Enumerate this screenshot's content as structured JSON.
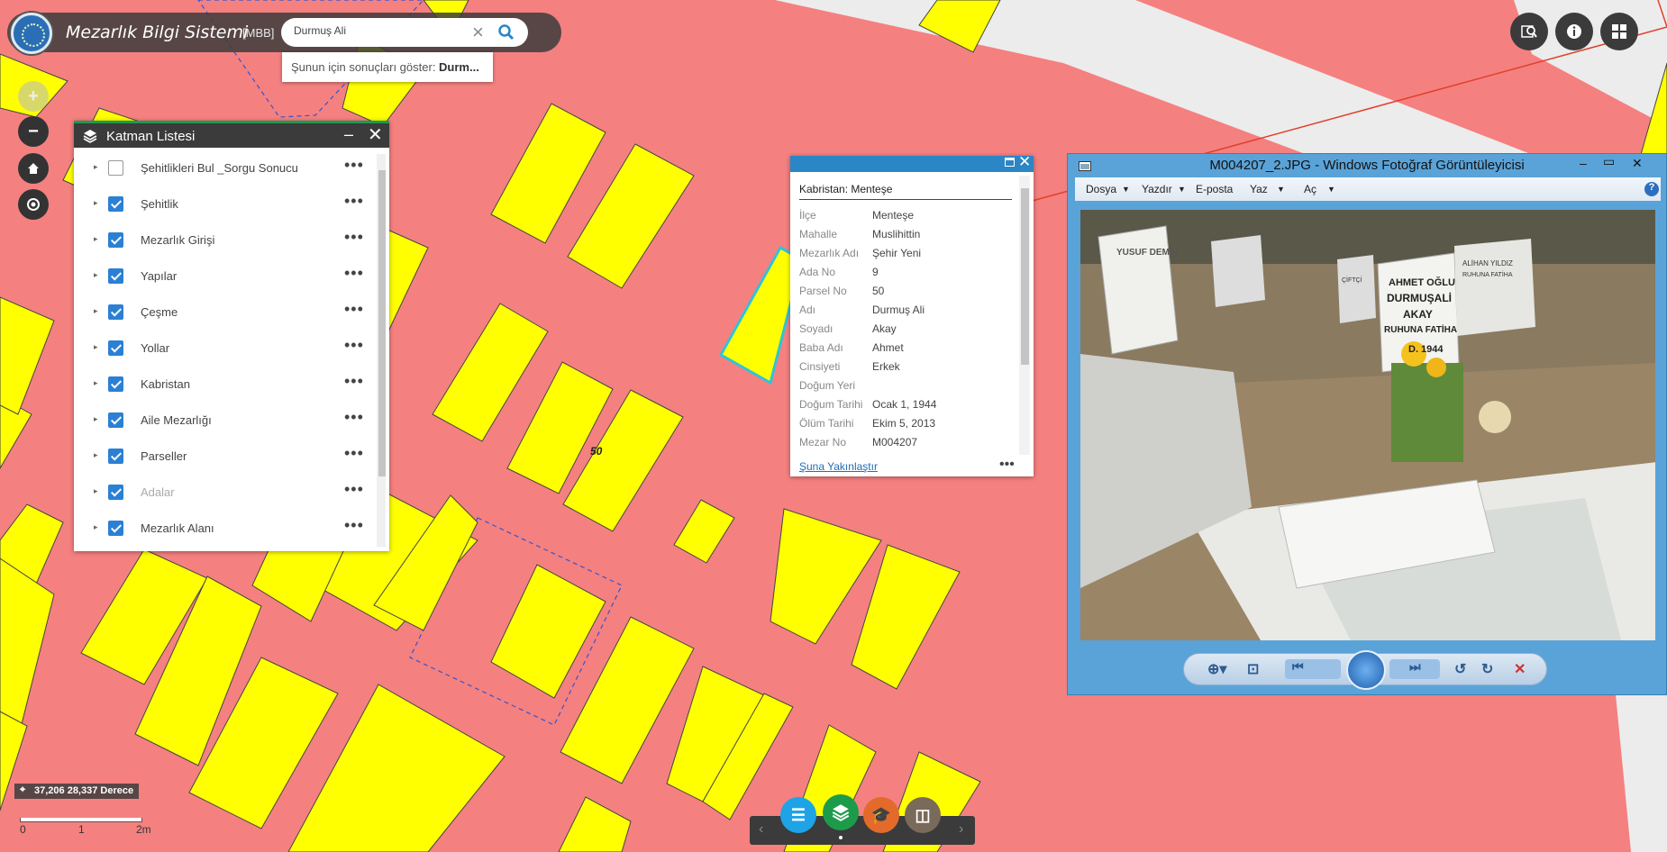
{
  "app": {
    "title": "Mezarlık Bilgi Sistemi",
    "tag": "[MBB]"
  },
  "search": {
    "value": "Durmuş Ali",
    "suggestion_prefix": "Şunun için sonuçları göster: ",
    "suggestion_term": "Durm..."
  },
  "layer_panel": {
    "title": "Katman Listesi",
    "items": [
      {
        "label": "Şehitlikleri Bul _Sorgu Sonucu",
        "checked": false
      },
      {
        "label": "Şehitlik",
        "checked": true
      },
      {
        "label": "Mezarlık Girişi",
        "checked": true
      },
      {
        "label": "Yapılar",
        "checked": true
      },
      {
        "label": "Çeşme",
        "checked": true
      },
      {
        "label": "Yollar",
        "checked": true
      },
      {
        "label": "Kabristan",
        "checked": true
      },
      {
        "label": "Aile Mezarlığı",
        "checked": true
      },
      {
        "label": "Parseller",
        "checked": true
      },
      {
        "label": "Adalar",
        "checked": true
      },
      {
        "label": "Mezarlık Alanı",
        "checked": true
      }
    ]
  },
  "map_label": "50",
  "popup": {
    "title": "Kabristan: Menteşe",
    "zoom_link": "Şuna Yakınlaştır",
    "fields": [
      {
        "k": "İlçe",
        "v": "Menteşe"
      },
      {
        "k": "Mahalle",
        "v": "Muslihittin"
      },
      {
        "k": "Mezarlık Adı",
        "v": "Şehir Yeni"
      },
      {
        "k": "Ada No",
        "v": "9"
      },
      {
        "k": "Parsel No",
        "v": "50"
      },
      {
        "k": "Adı",
        "v": "Durmuş Ali"
      },
      {
        "k": "Soyadı",
        "v": "Akay"
      },
      {
        "k": "Baba Adı",
        "v": "Ahmet"
      },
      {
        "k": "Cinsiyeti",
        "v": "Erkek"
      },
      {
        "k": "Doğum Yeri",
        "v": ""
      },
      {
        "k": "Doğum Tarihi",
        "v": "Ocak 1, 1944"
      },
      {
        "k": "Ölüm Tarihi",
        "v": "Ekim 5, 2013"
      },
      {
        "k": "Mezar No",
        "v": "M004207"
      }
    ]
  },
  "viewer": {
    "title": "M004207_2.JPG - Windows Fotoğraf Görüntüleyicisi",
    "menu": [
      "Dosya",
      "Yazdır",
      "E-posta",
      "Yaz",
      "Aç"
    ],
    "photo_text": {
      "left_stone": "YUSUF DEMİR",
      "main_stone": [
        "AHMET OĞLU",
        "DURMUŞALİ",
        "AKAY",
        "RUHUNA FATİHA",
        "D. 1944"
      ],
      "right_stone": [
        "ALİHAN YILDIZ",
        "RUHUNA FATİHA"
      ],
      "mid_stone": "ÇİFTÇİ"
    }
  },
  "status": {
    "coords": "37,206 28,337 Derece",
    "scale_labels": [
      "0",
      "1",
      "2m"
    ]
  },
  "colors": {
    "map_bg": "#f58080",
    "parcel": "#ffff00",
    "accent": "#2b86c5",
    "panel_header": "#3b3b3b"
  }
}
